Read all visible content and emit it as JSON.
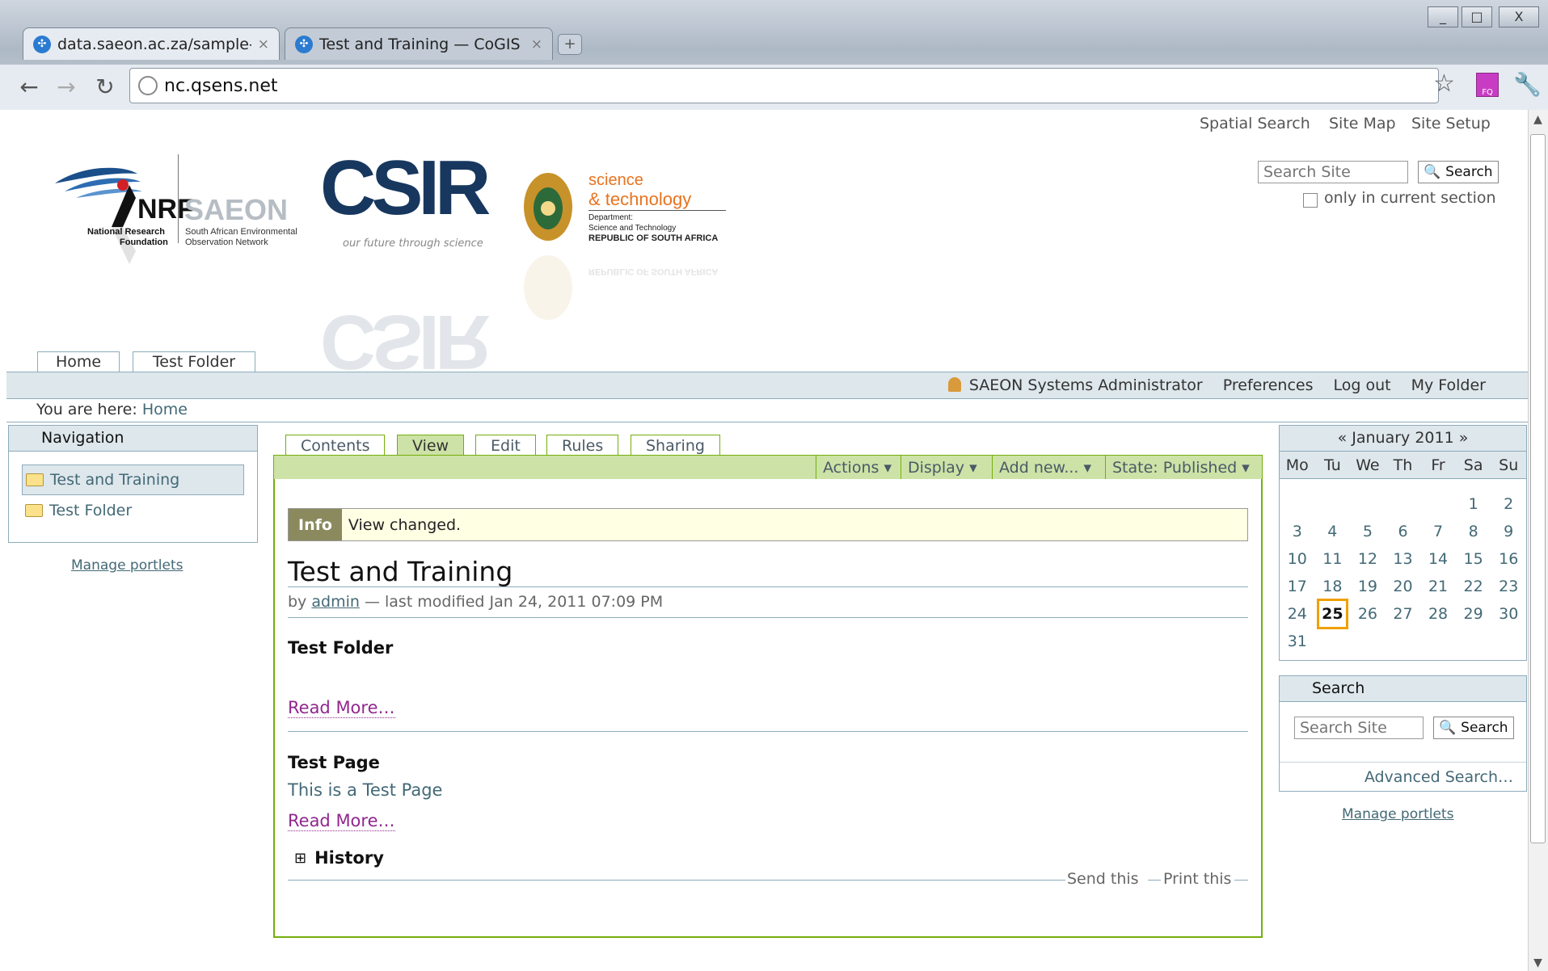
{
  "browser": {
    "tabs": [
      {
        "title": "data.saeon.ac.za/sample-...",
        "close": "×"
      },
      {
        "title": "Test and Training — CoGIS",
        "close": "×"
      }
    ],
    "url": "nc.qsens.net",
    "window_buttons": {
      "minimize": "_",
      "maximize": "□",
      "close": "X"
    }
  },
  "site_actions": [
    "Spatial Search",
    "Site Map",
    "Site Setup"
  ],
  "header_search": {
    "placeholder": "Search Site",
    "button": "Search",
    "checkbox_label": "only in current section"
  },
  "logos": {
    "nrf": {
      "name": "NRF",
      "line1": "National Research",
      "line2": "Foundation"
    },
    "saeon": {
      "name": "SAEON",
      "line1": "South African Environmental",
      "line2": "Observation Network"
    },
    "csir": {
      "name": "CSIR",
      "tagline": "our future through science"
    },
    "dst": {
      "line1": "science",
      "line2": "& technology",
      "line3": "Department:",
      "line4": "Science and Technology",
      "line5": "REPUBLIC OF SOUTH AFRICA"
    }
  },
  "portal_tabs": [
    "Home",
    "Test Folder"
  ],
  "personal_bar": {
    "user": "SAEON Systems Administrator",
    "links": [
      "Preferences",
      "Log out",
      "My Folder"
    ]
  },
  "breadcrumb": {
    "label": "You are here:",
    "current": "Home"
  },
  "navigation": {
    "title": "Navigation",
    "items": [
      "Test and Training",
      "Test Folder"
    ],
    "manage": "Manage portlets"
  },
  "content_tabs": [
    "Contents",
    "View",
    "Edit",
    "Rules",
    "Sharing"
  ],
  "content_actions": [
    "Actions ▾",
    "Display ▾",
    "Add new... ▾",
    "State: Published ▾"
  ],
  "message": {
    "label": "Info",
    "text": "View changed."
  },
  "document": {
    "title": "Test and Training",
    "byline_by": "by",
    "author": "admin",
    "byline_rest": "— last modified Jan 24, 2011 07:09 PM",
    "items": [
      {
        "title": "Test Folder",
        "description": "",
        "more": "Read More…"
      },
      {
        "title": "Test Page",
        "description": "This is a Test Page",
        "more": "Read More…"
      }
    ],
    "history": "History",
    "history_toggle": "⊞",
    "footer_links": [
      "Send this",
      "Print this"
    ]
  },
  "calendar": {
    "title": "« January 2011 »",
    "days": [
      "Mo",
      "Tu",
      "We",
      "Th",
      "Fr",
      "Sa",
      "Su"
    ],
    "weeks": [
      [
        "",
        "",
        "",
        "",
        "",
        "1",
        "2"
      ],
      [
        "3",
        "4",
        "5",
        "6",
        "7",
        "8",
        "9"
      ],
      [
        "10",
        "11",
        "12",
        "13",
        "14",
        "15",
        "16"
      ],
      [
        "17",
        "18",
        "19",
        "20",
        "21",
        "22",
        "23"
      ],
      [
        "24",
        "25",
        "26",
        "27",
        "28",
        "29",
        "30"
      ],
      [
        "31",
        "",
        "",
        "",
        "",
        "",
        ""
      ]
    ],
    "today": "25"
  },
  "search_portlet": {
    "title": "Search",
    "placeholder": "Search Site",
    "button": "Search",
    "advanced": "Advanced Search…",
    "manage": "Manage portlets"
  },
  "colors": {
    "portal_blue": "#dee7ec",
    "portal_border": "#8cacbb",
    "action_green": "#cde2a7",
    "green_border": "#74ae0b",
    "link": "#436976",
    "visited": "#91278e",
    "today": "#f0a000"
  }
}
